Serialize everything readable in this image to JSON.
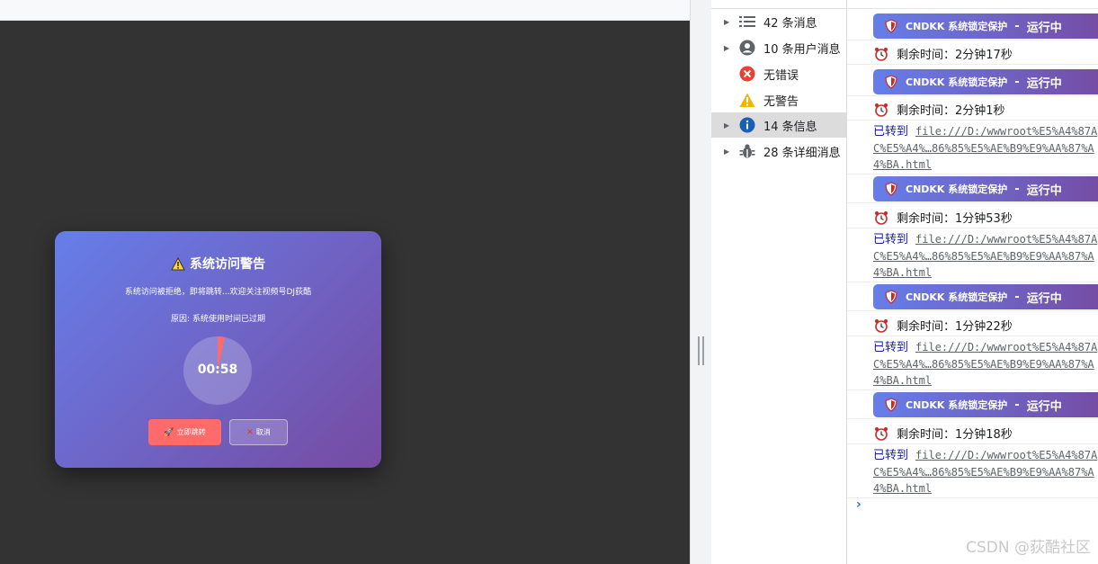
{
  "modal": {
    "title": "系统访问警告",
    "message": "系统访问被拒绝，即将跳转...欢迎关注视频号DJ荻酷",
    "reason": "原因: 系统使用时间已过期",
    "countdown": "00:58",
    "countdown_progress": 0.033,
    "redirect_button": "立即跳转",
    "cancel_button": "取消",
    "warn_icon": "warning-icon",
    "colors": {
      "gradient_start": "#667eea",
      "gradient_end": "#764ba2",
      "primary_button": "#ff6b6b",
      "countdown_arc": "#ff6b6b"
    }
  },
  "console_sidebar": {
    "items": [
      {
        "label": "42 条消息",
        "icon": "list-icon",
        "expandable": true,
        "selected": false
      },
      {
        "label": "10 条用户消息",
        "icon": "user-icon",
        "expandable": true,
        "selected": false
      },
      {
        "label": "无错误",
        "icon": "error-icon",
        "expandable": false,
        "selected": false
      },
      {
        "label": "无警告",
        "icon": "warning-icon",
        "expandable": false,
        "selected": false
      },
      {
        "label": "14 条信息",
        "icon": "info-icon",
        "expandable": true,
        "selected": true
      },
      {
        "label": "28 条详细消息",
        "icon": "bug-icon",
        "expandable": true,
        "selected": false
      }
    ]
  },
  "console_log": {
    "banner_text": "CNDKK 系统锁定保护",
    "banner_separator": "-",
    "banner_status": "运行中",
    "redirect_label": "已转到",
    "redirect_url": "file:///D:/wwwroot%E5%A4%87AC%E5%A4%…86%85%E5%AE%B9%E9%AA%87%A4%BA.html",
    "time_prefix": "剩余时间：",
    "times": [
      "2分钟17秒",
      "2分钟1秒",
      "1分钟53秒",
      "1分钟22秒",
      "1分钟18秒"
    ],
    "prompt": "›"
  },
  "watermark": "CSDN @荻酷社区"
}
